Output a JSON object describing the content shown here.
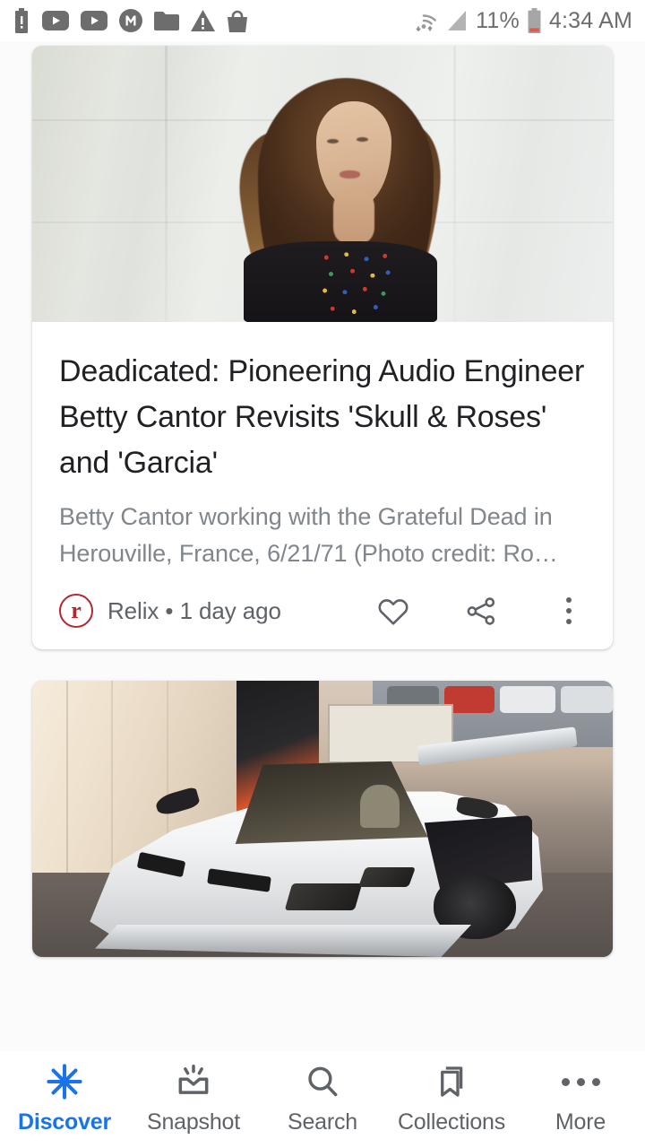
{
  "status_bar": {
    "time": "4:34 AM",
    "battery_percent": "11%",
    "left_icons": [
      "battery-alert-icon",
      "youtube-icon",
      "youtube-icon",
      "m-circle-icon",
      "folder-icon",
      "warning-triangle-icon",
      "shopping-bag-icon"
    ],
    "right_icons": [
      "wifi-icon",
      "cellular-signal-icon",
      "battery-low-icon"
    ],
    "icon_color": "#6d6d6d",
    "background": "#ffffff"
  },
  "feed": {
    "background": "#fbfbfb",
    "cards": [
      {
        "image_alt": "Woman with long brown hair standing in front of a pale gray wall wearing a dark top with colorful embroidery",
        "headline": "Deadicated: Pioneering Audio Engineer Betty Cantor Revisits 'Skull & Roses' and 'Garcia'",
        "snippet": "Betty Cantor working with the Grateful Dead in Herouville, France, 6/21/71 (Photo credit: Ro…",
        "source_name": "Relix",
        "source_logo_letter": "r",
        "source_logo_color": "#b3272d",
        "separator": "•",
        "timestamp": "1 day ago",
        "actions": [
          "heart-icon",
          "share-icon",
          "overflow-menu-icon"
        ]
      },
      {
        "image_alt": "White Lamborghini Aventador roadster parked under a tent canopy with a parking lot in the background"
      }
    ]
  },
  "bottom_nav": {
    "active_color": "#1a73e8",
    "inactive_color": "#5f6368",
    "items": [
      {
        "label": "Discover",
        "icon": "discover-asterisk-icon",
        "active": true
      },
      {
        "label": "Snapshot",
        "icon": "snapshot-tray-icon",
        "active": false
      },
      {
        "label": "Search",
        "icon": "search-magnifier-icon",
        "active": false
      },
      {
        "label": "Collections",
        "icon": "bookmark-icon",
        "active": false
      },
      {
        "label": "More",
        "icon": "more-dots-icon",
        "active": false
      }
    ]
  }
}
